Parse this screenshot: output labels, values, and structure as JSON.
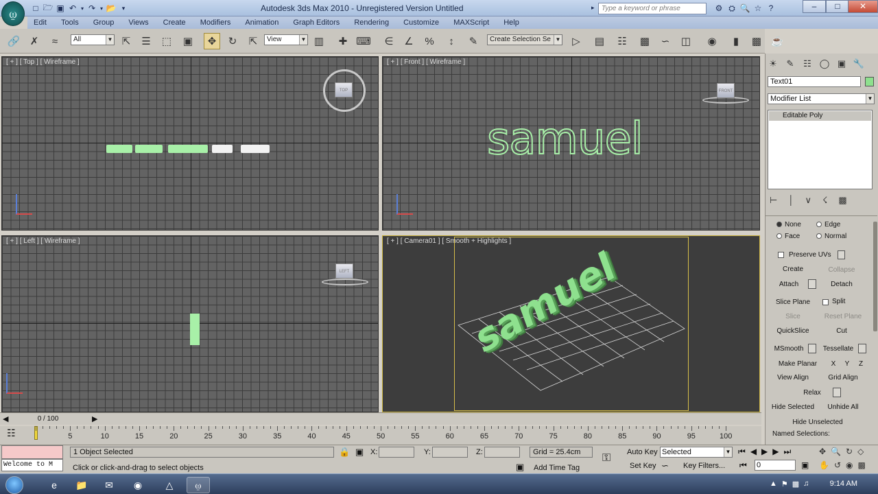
{
  "app": {
    "title": "Autodesk 3ds Max  2010  -  Unregistered Version     Untitled",
    "search_placeholder": "Type a keyword or phrase"
  },
  "menu": [
    "Edit",
    "Tools",
    "Group",
    "Views",
    "Create",
    "Modifiers",
    "Animation",
    "Graph Editors",
    "Rendering",
    "Customize",
    "MAXScript",
    "Help"
  ],
  "toolbar": {
    "filter": "All",
    "ref_coord": "View",
    "named_sel": "Create Selection Se"
  },
  "viewports": {
    "top": {
      "label": "[ + ] [ Top ] [ Wireframe ]"
    },
    "front": {
      "label": "[ + ] [ Front ] [ Wireframe ]",
      "text": "samuel"
    },
    "left": {
      "label": "[ + ] [ Left ] [ Wireframe ]"
    },
    "camera": {
      "label": "[ + ] [ Camera01 ] [ Smooth + Highlights ]",
      "text": "samuel"
    }
  },
  "panel": {
    "object_name": "Text01",
    "object_color": "#8ee08e",
    "modifier_list": "Modifier List",
    "stack_item": "Editable Poly",
    "radios": {
      "none": "None",
      "edge": "Edge",
      "face": "Face",
      "normal": "Normal"
    },
    "preserve_uvs": "Preserve UVs",
    "buttons": {
      "create": "Create",
      "collapse": "Collapse",
      "attach": "Attach",
      "detach": "Detach",
      "slice_plane": "Slice Plane",
      "split": "Split",
      "slice": "Slice",
      "reset_plane": "Reset Plane",
      "quickslice": "QuickSlice",
      "cut": "Cut",
      "msmooth": "MSmooth",
      "tessellate": "Tessellate",
      "make_planar": "Make Planar",
      "x": "X",
      "y": "Y",
      "z": "Z",
      "view_align": "View Align",
      "grid_align": "Grid Align",
      "relax": "Relax",
      "hide_selected": "Hide Selected",
      "unhide_all": "Unhide All",
      "hide_unselected": "Hide Unselected"
    },
    "named_selections": "Named Selections:"
  },
  "timeline": {
    "frame": "0 / 100",
    "ticks": [
      "5",
      "10",
      "15",
      "20",
      "25",
      "30",
      "35",
      "40",
      "45",
      "50",
      "55",
      "60",
      "65",
      "70",
      "75",
      "80",
      "85",
      "90",
      "95",
      "100"
    ]
  },
  "status": {
    "listener": "Welcome to M",
    "selection": "1 Object Selected",
    "prompt": "Click or click-and-drag to select objects",
    "x_label": "X:",
    "y_label": "Y:",
    "z_label": "Z:",
    "grid": "Grid = 25.4cm",
    "add_time_tag": "Add Time Tag",
    "auto_key": "Auto Key",
    "set_key": "Set Key",
    "key_mode": "Selected",
    "key_filters": "Key Filters...",
    "frame_value": "0"
  },
  "taskbar": {
    "clock": "9:14 AM"
  }
}
